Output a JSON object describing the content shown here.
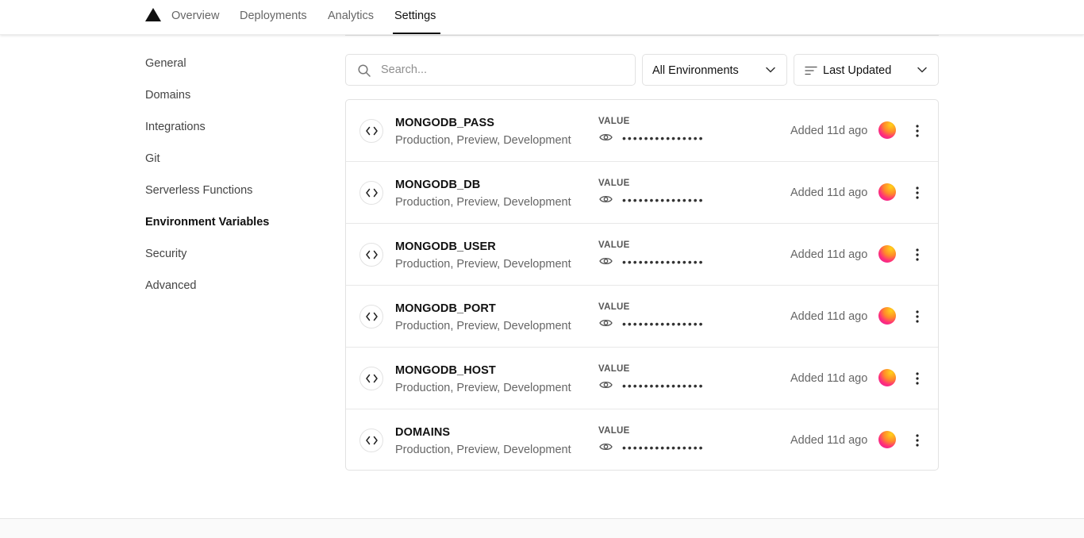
{
  "nav": {
    "logo_icon": "triangle-logo-icon",
    "tabs": [
      {
        "label": "Overview",
        "active": false
      },
      {
        "label": "Deployments",
        "active": false
      },
      {
        "label": "Analytics",
        "active": false
      },
      {
        "label": "Settings",
        "active": true
      }
    ]
  },
  "sidebar": {
    "items": [
      {
        "label": "General",
        "active": false
      },
      {
        "label": "Domains",
        "active": false
      },
      {
        "label": "Integrations",
        "active": false
      },
      {
        "label": "Git",
        "active": false
      },
      {
        "label": "Serverless Functions",
        "active": false
      },
      {
        "label": "Environment Variables",
        "active": true
      },
      {
        "label": "Security",
        "active": false
      },
      {
        "label": "Advanced",
        "active": false
      }
    ]
  },
  "filters": {
    "search_placeholder": "Search...",
    "search_value": "",
    "environment_selected": "All Environments",
    "sort_selected": "Last Updated"
  },
  "variables": [
    {
      "name": "MONGODB_PASS",
      "environments": "Production, Preview, Development",
      "value_label": "VALUE",
      "masked_value": "•••••••••••••••",
      "added": "Added 11d ago"
    },
    {
      "name": "MONGODB_DB",
      "environments": "Production, Preview, Development",
      "value_label": "VALUE",
      "masked_value": "•••••••••••••••",
      "added": "Added 11d ago"
    },
    {
      "name": "MONGODB_USER",
      "environments": "Production, Preview, Development",
      "value_label": "VALUE",
      "masked_value": "•••••••••••••••",
      "added": "Added 11d ago"
    },
    {
      "name": "MONGODB_PORT",
      "environments": "Production, Preview, Development",
      "value_label": "VALUE",
      "masked_value": "•••••••••••••••",
      "added": "Added 11d ago"
    },
    {
      "name": "MONGODB_HOST",
      "environments": "Production, Preview, Development",
      "value_label": "VALUE",
      "masked_value": "•••••••••••••••",
      "added": "Added 11d ago"
    },
    {
      "name": "DOMAINS",
      "environments": "Production, Preview, Development",
      "value_label": "VALUE",
      "masked_value": "•••••••••••••••",
      "added": "Added 11d ago"
    }
  ],
  "colors": {
    "text_primary": "#111111",
    "text_secondary": "#666666",
    "border": "#e2e2e2",
    "avatar_gradient": [
      "#ffd21a",
      "#ff8a2a",
      "#ff2f7a",
      "#e01aa2"
    ]
  }
}
